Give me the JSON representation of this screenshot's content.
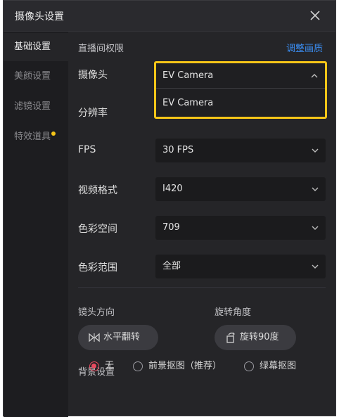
{
  "window": {
    "title": "摄像头设置"
  },
  "sidebar": {
    "items": [
      {
        "label": "基础设置",
        "active": true
      },
      {
        "label": "美颜设置",
        "active": false
      },
      {
        "label": "滤镜设置",
        "active": false
      },
      {
        "label": "特效道具",
        "active": false,
        "badge_dot": true
      }
    ]
  },
  "content": {
    "section_title": "直播间权限",
    "adjust_link": "调整画质",
    "camera": {
      "label": "摄像头",
      "selected": "EV Camera",
      "options": [
        "EV Camera"
      ]
    },
    "resolution": {
      "label": "分辨率"
    },
    "fps": {
      "label": "FPS",
      "value": "30 FPS"
    },
    "video_format": {
      "label": "视频格式",
      "value": "I420"
    },
    "color_space": {
      "label": "色彩空间",
      "value": "709"
    },
    "color_range": {
      "label": "色彩范围",
      "value": "全部"
    },
    "lens_direction": {
      "label": "镜头方向",
      "button": "水平翻转"
    },
    "rotation": {
      "label": "旋转角度",
      "button": "旋转90度"
    },
    "background": {
      "label": "背景设置",
      "options": [
        {
          "label": "无",
          "checked": true
        },
        {
          "label": "前景抠图（推荐）",
          "checked": false
        },
        {
          "label": "绿幕抠图",
          "checked": false
        }
      ]
    }
  },
  "colors": {
    "accent_highlight": "#f5c518",
    "link": "#3b8ff5",
    "radio_checked": "#e84a5f"
  }
}
